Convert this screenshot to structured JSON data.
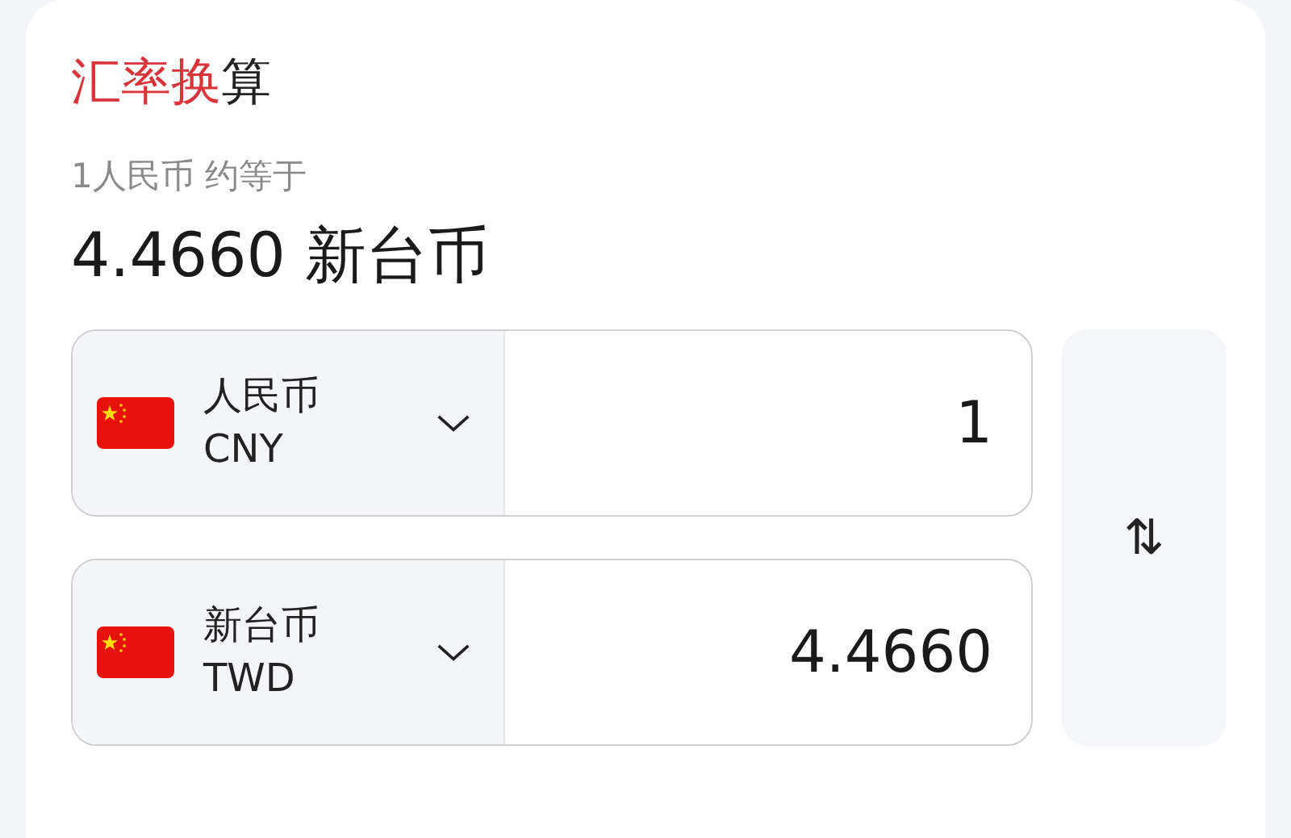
{
  "title": {
    "highlight": "汇率换",
    "rest": "算"
  },
  "rate_caption": "1人民币 约等于",
  "rate_result": "4.4660 新台币",
  "currencies": [
    {
      "name": "人民币",
      "code": "CNY",
      "value": "1"
    },
    {
      "name": "新台币",
      "code": "TWD",
      "value": "4.4660"
    }
  ],
  "swap_button": "⇅"
}
